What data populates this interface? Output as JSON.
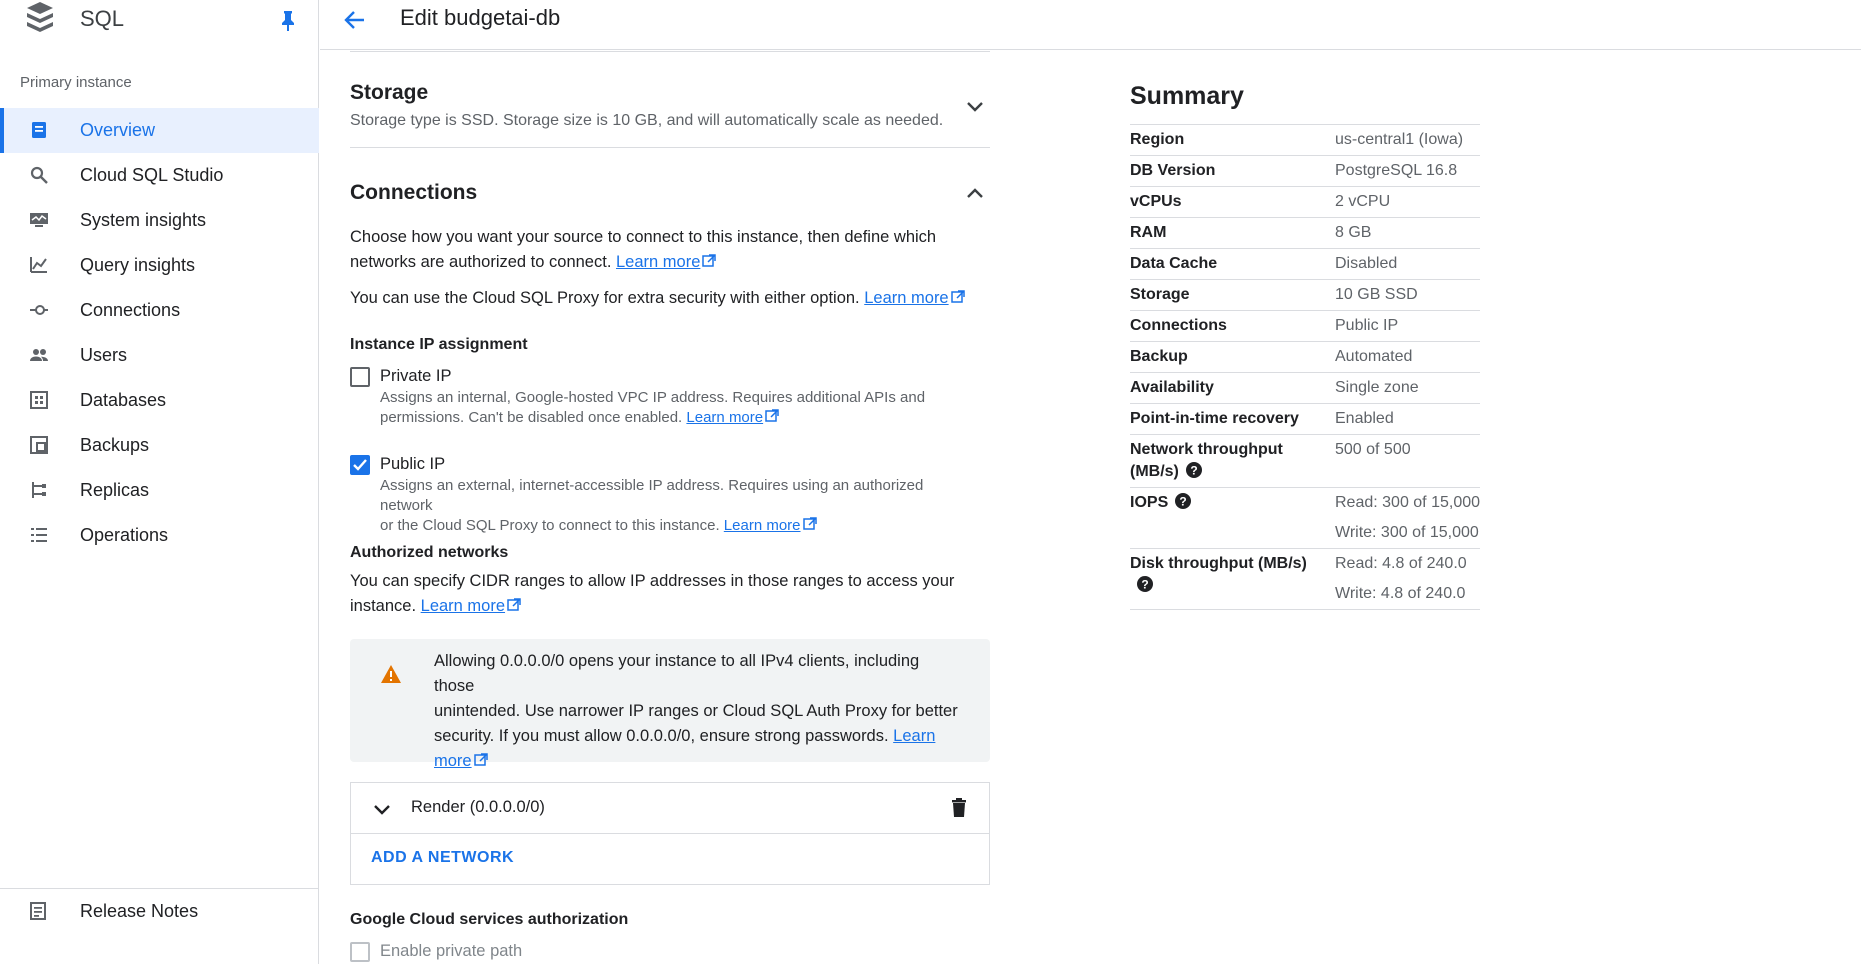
{
  "app": {
    "title": "SQL"
  },
  "sidebar": {
    "section_label": "Primary instance",
    "items": [
      {
        "label": "Overview",
        "icon": "overview-icon",
        "active": true
      },
      {
        "label": "Cloud SQL Studio",
        "icon": "search-icon"
      },
      {
        "label": "System insights",
        "icon": "monitor-icon"
      },
      {
        "label": "Query insights",
        "icon": "chart-icon"
      },
      {
        "label": "Connections",
        "icon": "connections-icon"
      },
      {
        "label": "Users",
        "icon": "users-icon"
      },
      {
        "label": "Databases",
        "icon": "databases-icon"
      },
      {
        "label": "Backups",
        "icon": "backups-icon"
      },
      {
        "label": "Replicas",
        "icon": "replicas-icon"
      },
      {
        "label": "Operations",
        "icon": "operations-icon"
      }
    ],
    "bottom_item": {
      "label": "Release Notes",
      "icon": "release-notes-icon"
    }
  },
  "header": {
    "title": "Edit budgetai-db"
  },
  "storage": {
    "title": "Storage",
    "description": "Storage type is SSD. Storage size is 10 GB, and will automatically scale as needed."
  },
  "connections": {
    "title": "Connections",
    "intro_1": "Choose how you want your source to connect to this instance, then define which",
    "intro_2": "networks are authorized to connect.",
    "learn_more": "Learn more",
    "proxy_text": "You can use the Cloud SQL Proxy for extra security with either option.",
    "ip_assignment_label": "Instance IP assignment",
    "private_ip": {
      "label": "Private IP",
      "checked": false,
      "desc_1": "Assigns an internal, Google-hosted VPC IP address. Requires additional APIs and",
      "desc_2": "permissions. Can't be disabled once enabled."
    },
    "public_ip": {
      "label": "Public IP",
      "checked": true,
      "desc_1": "Assigns an external, internet-accessible IP address. Requires using an authorized network",
      "desc_2": "or the Cloud SQL Proxy to connect to this instance."
    },
    "authorized_networks_label": "Authorized networks",
    "authorized_text_1": "You can specify CIDR ranges to allow IP addresses in those ranges to access your",
    "authorized_text_2": "instance.",
    "warning": {
      "line_1": "Allowing 0.0.0.0/0 opens your instance to all IPv4 clients, including those",
      "line_2": "unintended. Use narrower IP ranges or Cloud SQL Auth Proxy for better",
      "line_3": "security. If you must allow 0.0.0.0/0, ensure strong passwords.",
      "learn": "Learn",
      "more": "more"
    },
    "network": {
      "name": "Render (0.0.0.0/0)"
    },
    "add_network": "ADD A NETWORK",
    "gcs_auth_label": "Google Cloud services authorization",
    "private_path": {
      "label": "Enable private path",
      "checked": false
    }
  },
  "summary": {
    "title": "Summary",
    "rows": [
      {
        "key": "Region",
        "value": "us-central1 (Iowa)"
      },
      {
        "key": "DB Version",
        "value": "PostgreSQL 16.8"
      },
      {
        "key": "vCPUs",
        "value": "2 vCPU"
      },
      {
        "key": "RAM",
        "value": "8 GB"
      },
      {
        "key": "Data Cache",
        "value": "Disabled"
      },
      {
        "key": "Storage",
        "value": "10 GB SSD"
      },
      {
        "key": "Connections",
        "value": "Public IP"
      },
      {
        "key": "Backup",
        "value": "Automated"
      },
      {
        "key": "Availability",
        "value": "Single zone"
      },
      {
        "key": "Point-in-time recovery",
        "value": "Enabled"
      }
    ],
    "throughput": {
      "key_1": "Network throughput",
      "key_2": "(MB/s)",
      "value": "500 of 500"
    },
    "iops": {
      "key": "IOPS",
      "read": "Read: 300 of 15,000",
      "write": "Write: 300 of 15,000"
    },
    "disk": {
      "key": "Disk throughput (MB/s)",
      "read": "Read: 4.8 of 240.0",
      "write": "Write: 4.8 of 240.0"
    }
  },
  "colors": {
    "accent": "#1a73e8",
    "warning": "#e37400",
    "active_bg": "#e8f0fe"
  }
}
